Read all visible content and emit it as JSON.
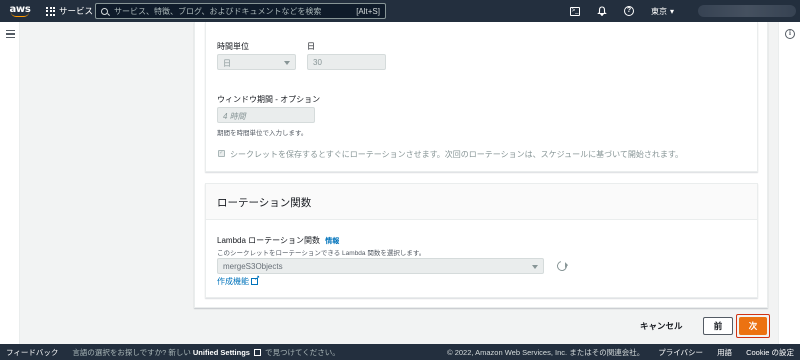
{
  "topnav": {
    "logo_text": "aws",
    "services_label": "サービス",
    "search_placeholder": "サービス、特徴、ブログ、およびドキュメントなどを検索",
    "search_shortcut": "[Alt+S]",
    "region_label": "東京",
    "icons": [
      "cloudshell-icon",
      "bell-icon",
      "help-icon"
    ]
  },
  "form": {
    "time_unit_label": "時間単位",
    "time_unit_value": "日",
    "day_label": "日",
    "day_value": "30",
    "window_label": "ウィンドウ期間 - オプション",
    "window_value": "4 時間",
    "window_hint": "期間を時間単位で入力します。",
    "rotate_checkbox_label": "シークレットを保存するとすぐにローテーションさせます。次回のローテーションは、スケジュールに基づいて開始されます。",
    "rotate_checked": true
  },
  "rotation": {
    "title": "ローテーション関数",
    "lambda_label": "Lambda ローテーション関数",
    "info_link": "情報",
    "lambda_hint": "このシークレットをローテーションできる Lambda 関数を選択します。",
    "lambda_value": "mergeS3Objects",
    "create_link": "作成機能"
  },
  "actions": {
    "cancel": "キャンセル",
    "previous": "前",
    "next": "次"
  },
  "footer": {
    "feedback": "フィードバック",
    "lang_prefix": "言語の選択をお探しですか? 新しい",
    "lang_bold": "Unified Settings",
    "lang_suffix": "で見つけてください。",
    "copyright": "© 2022, Amazon Web Services, Inc. またはその関連会社。",
    "privacy": "プライバシー",
    "terms": "用語",
    "cookie": "Cookie の設定"
  },
  "colors": {
    "nav_bg": "#232f3e",
    "primary_button": "#ec7211",
    "link": "#0073bb",
    "highlight_outline": "#d13212"
  }
}
